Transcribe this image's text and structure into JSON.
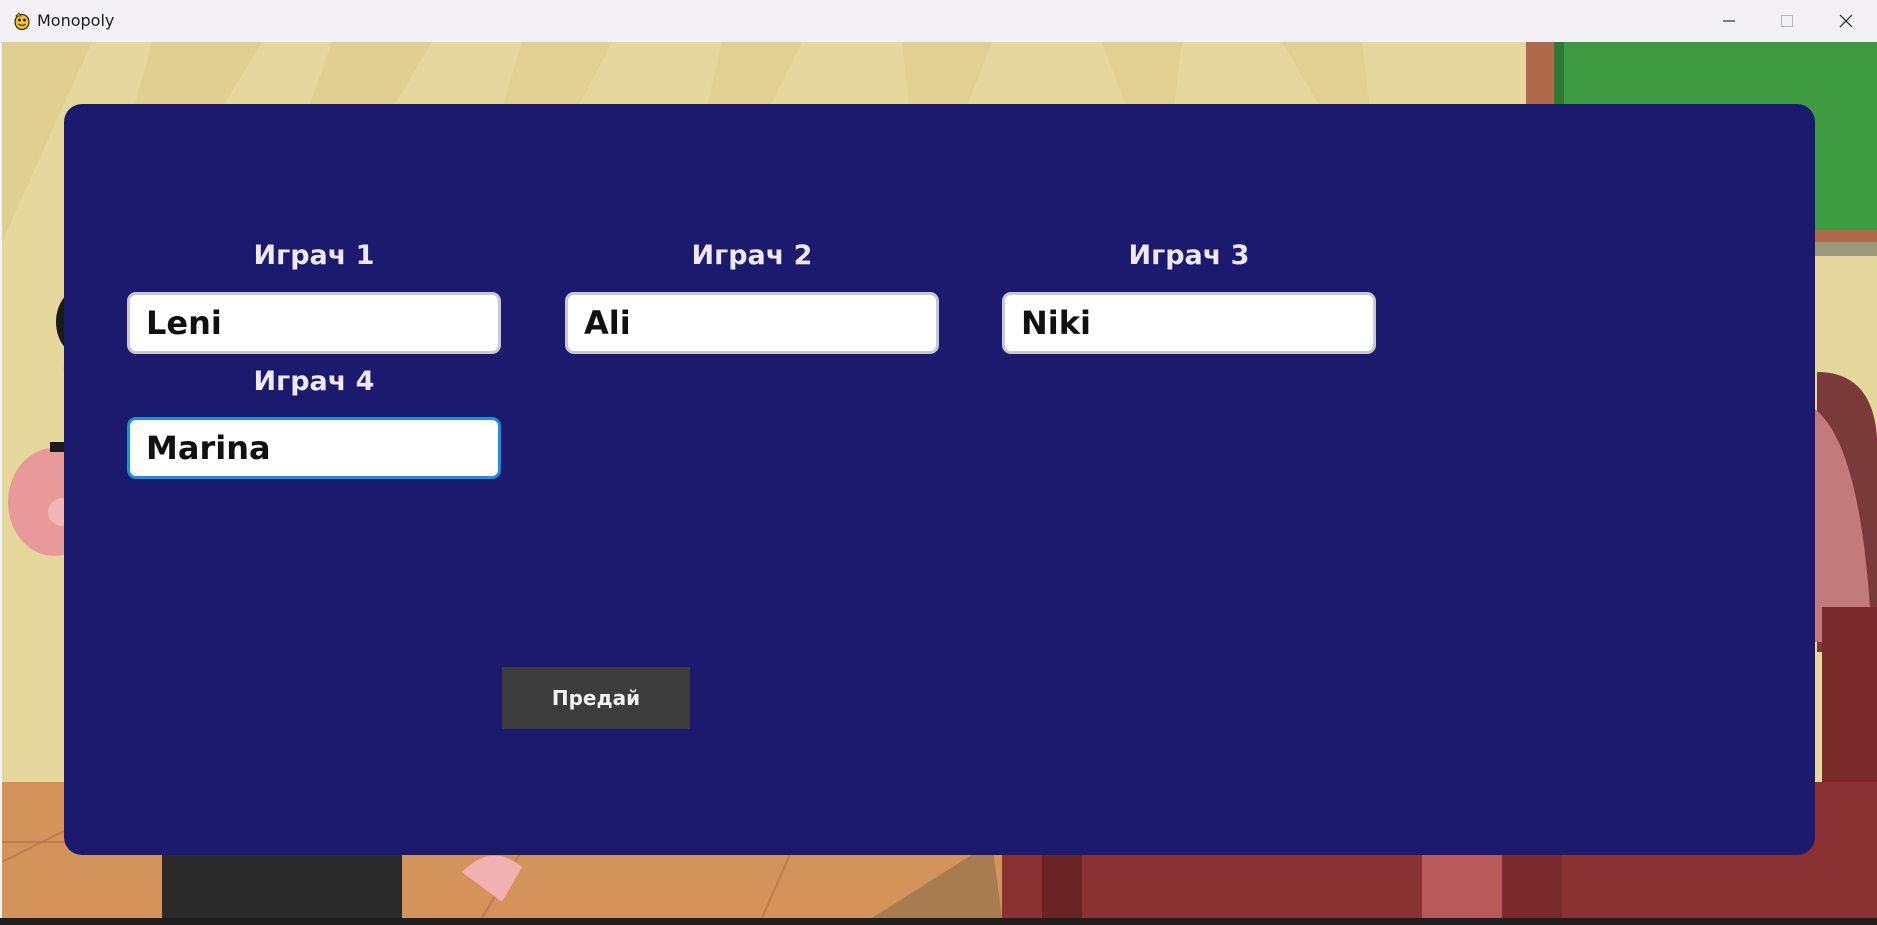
{
  "window": {
    "title": "Monopoly"
  },
  "players": [
    {
      "label": "Играч 1",
      "value": "Leni"
    },
    {
      "label": "Играч 2",
      "value": "Ali"
    },
    {
      "label": "Играч 3",
      "value": "Niki"
    },
    {
      "label": "Играч 4",
      "value": "Marina"
    }
  ],
  "submit_label": "Предай",
  "colors": {
    "panel": "#1b1a6e",
    "focus_border": "#1a8fe6",
    "button": "#3c3c3c"
  }
}
